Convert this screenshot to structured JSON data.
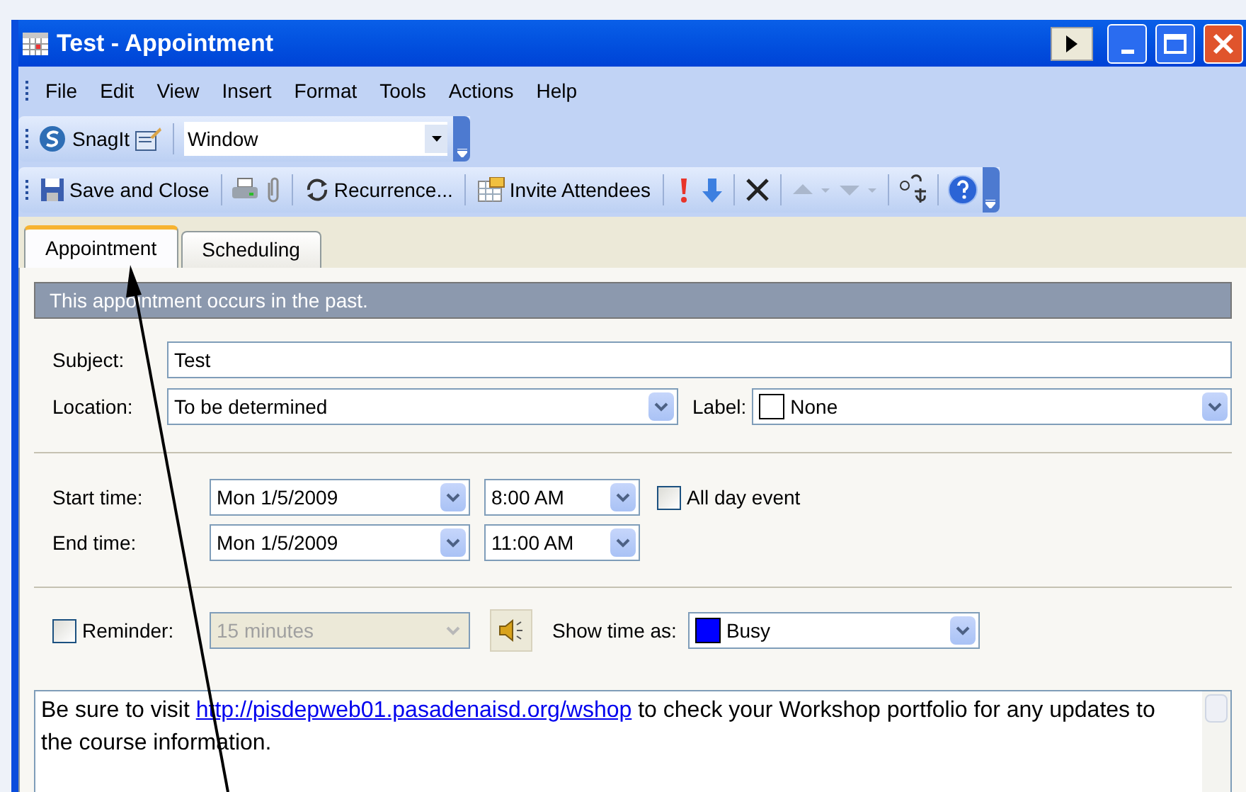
{
  "window": {
    "title": "Test - Appointment"
  },
  "menu": [
    "File",
    "Edit",
    "View",
    "Insert",
    "Format",
    "Tools",
    "Actions",
    "Help"
  ],
  "snagit_toolbar": {
    "label": "SnagIt",
    "dropdown": "Window"
  },
  "toolbar": {
    "save": "Save and Close",
    "recurrence": "Recurrence...",
    "invite": "Invite Attendees",
    "nav_buttons": [
      {
        "disabled": true
      },
      {
        "disabled": true
      }
    ]
  },
  "tabs": [
    {
      "label": "Appointment",
      "selected": true
    },
    {
      "label": "Scheduling",
      "selected": false
    }
  ],
  "info_banner": "This appointment occurs in the past.",
  "subject": {
    "label": "Subject:",
    "value": "Test"
  },
  "location": {
    "label": "Location:",
    "value": "To be determined"
  },
  "label_field": {
    "label": "Label:",
    "value": "None",
    "color": "#ffffff"
  },
  "start": {
    "label": "Start time:",
    "date": "Mon 1/5/2009",
    "time": "8:00 AM"
  },
  "end": {
    "label": "End time:",
    "date": "Mon 1/5/2009",
    "time": "11:00 AM"
  },
  "all_day": {
    "label": "All day event",
    "checked": false
  },
  "reminder": {
    "label": "Reminder:",
    "checked": false,
    "value": "15 minutes",
    "disabled": true
  },
  "show_time_as": {
    "label": "Show time as:",
    "value": "Busy",
    "color": "#0000ff"
  },
  "notes": {
    "before": "Be sure to visit ",
    "link": "http://pisdepweb01.pasadenaisd.org/wshop",
    "after": " to check your Workshop portfolio for any updates to the course information."
  }
}
